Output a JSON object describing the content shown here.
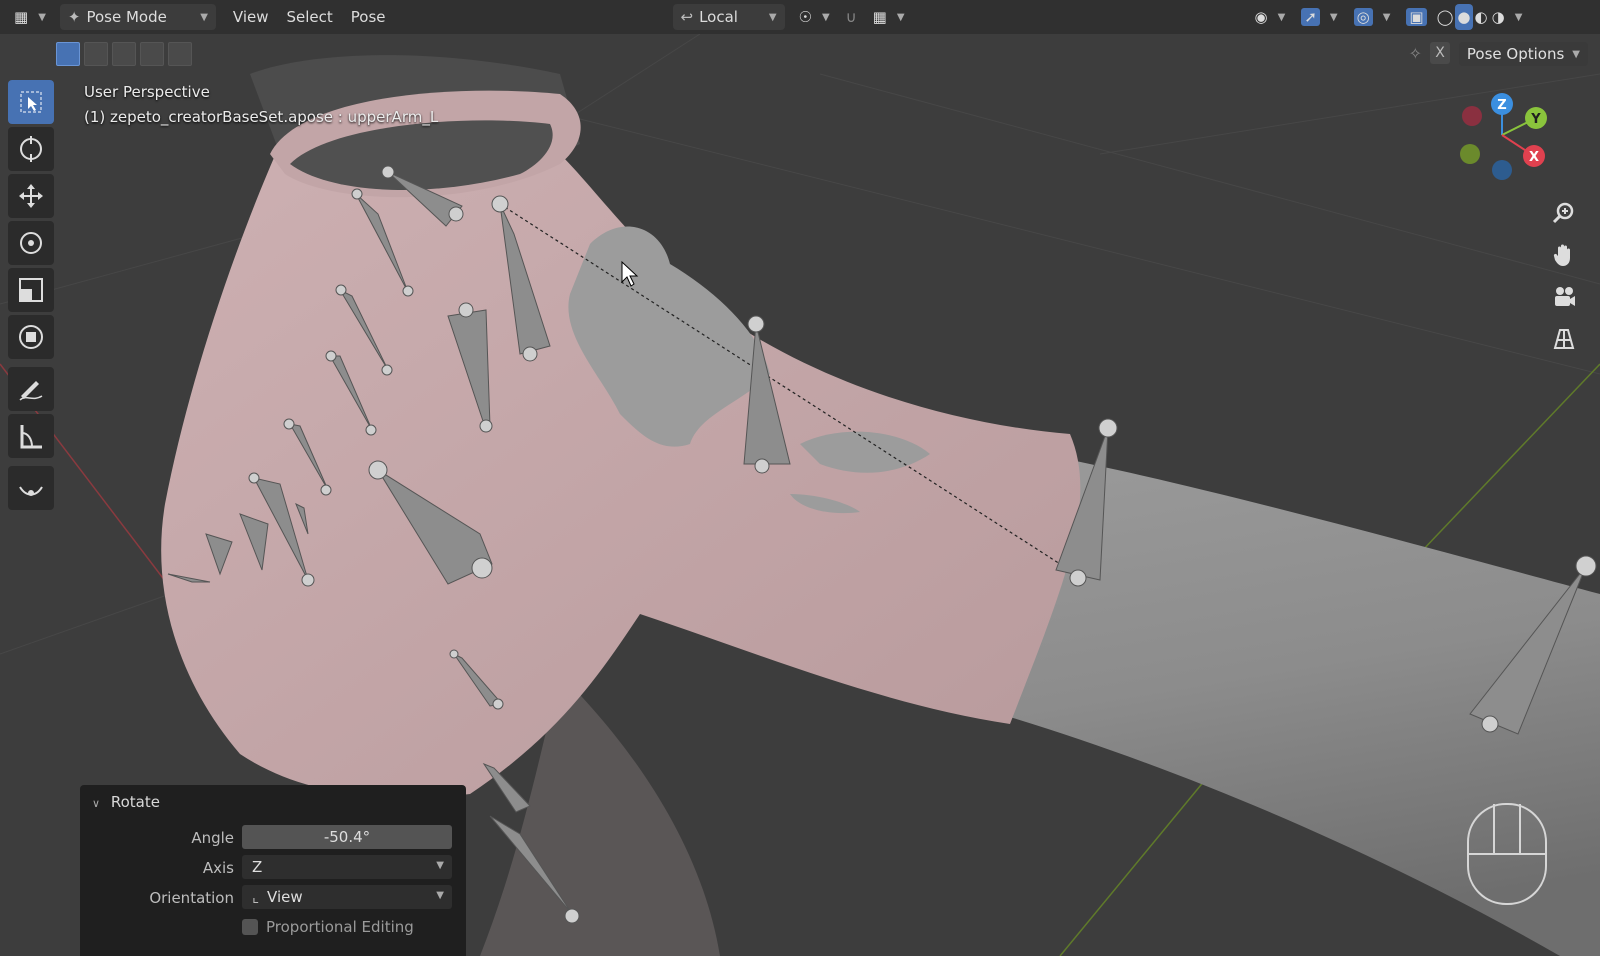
{
  "header": {
    "mode_label": "Pose Mode",
    "menus": [
      "View",
      "Select",
      "Pose"
    ],
    "transform_orientation": "Local"
  },
  "subbar": {
    "pose_options_label": "Pose Options",
    "x_label": "X"
  },
  "viewport": {
    "perspective_label": "User Perspective",
    "object_label": "(1) zepeto_creatorBaseSet.apose : upperArm_L"
  },
  "gizmo": {
    "z_label": "Z",
    "y_label": "Y",
    "x_label": "X"
  },
  "operator_panel": {
    "title": "Rotate",
    "angle_label": "Angle",
    "angle_value": "-50.4°",
    "axis_label": "Axis",
    "axis_value": "Z",
    "orientation_label": "Orientation",
    "orientation_value": "View",
    "proportional_label": "Proportional Editing"
  },
  "colors": {
    "header_bg": "#303030",
    "viewport_bg": "#3a3a3a",
    "active_blue": "#4772b3",
    "skin": "#c7aaac",
    "sleeve_gray": "#8a8a8a",
    "axis_x_red": "#e0414f",
    "axis_y_green": "#8ac43c",
    "axis_z_blue": "#3b8fe0"
  }
}
